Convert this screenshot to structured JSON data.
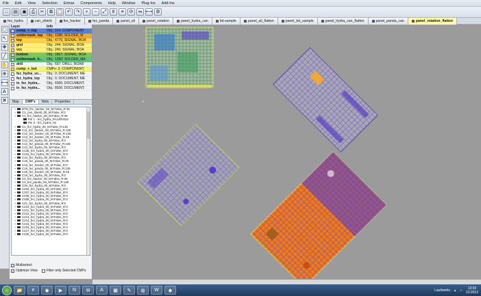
{
  "menu": [
    "File",
    "Edit",
    "View",
    "Selection",
    "Extras",
    "Components",
    "Help",
    "Window",
    "Plug-Ins",
    "Add-Ins"
  ],
  "toolbar_icons": [
    "new-icon",
    "open-icon",
    "save-icon",
    "print-icon",
    "cut-icon",
    "copy-icon",
    "paste-icon",
    "undo-icon",
    "redo-icon",
    "zoom-in-icon",
    "zoom-out-icon",
    "zoom-fit-icon",
    "grid-icon",
    "layer-icon",
    "rotate-icon",
    "mirror-icon",
    "measure-icon",
    "settings-icon"
  ],
  "tabs": [
    "fez_hydra",
    "can_shield",
    "fez_hacker",
    "fez_panda",
    "panel_all",
    "panel_rotation",
    "panel_hydra_can",
    "bd-sample",
    "panel_all_flatten",
    "panel_bd_sample",
    "panel_hydra_can_flatten",
    "panel_panda_can",
    "panel_rotation_flatten"
  ],
  "active_tab": "panel_rotation_flatten",
  "layer_panel": {
    "title": "Layer",
    "col_info": "Info",
    "layers": [
      {
        "name": "comp_+_top",
        "info": "Obj.: 114; COMPONENT",
        "color": "#5a7fd0"
      },
      {
        "name": "soldermask_top",
        "info": "Obj.: 1388; SOLDER_M",
        "color": "#f0a830"
      },
      {
        "name": "top",
        "info": "Obj.: 4775; SIGNAL; BOA",
        "color": "#ffd24a"
      },
      {
        "name": "gnd",
        "info": "Obj.: 244; SIGNAL; BOA",
        "color": "#ffef7a"
      },
      {
        "name": "vcc",
        "info": "Obj.: 240; SIGNAL; BOA",
        "color": "#ffef7a"
      },
      {
        "name": "bottom",
        "info": "Obj.: 1867; SIGNAL; BOA",
        "color": "#7ec85a"
      },
      {
        "name": "soldermask_b...",
        "info": "Obj.: 1282; SOLDER_MA",
        "color": "#66c27a"
      },
      {
        "name": "drill",
        "info": "Obj.: 697; DRILL; BOAR",
        "color": "#f2f3f5"
      },
      {
        "name": "comp_+_bot",
        "info": "CMPs: 3; COMPONENT;",
        "color": "#f4f37a"
      },
      {
        "name": "fez_hydra_so...",
        "info": "Obj.: 0; DOCUMENT; ME",
        "color": "#f2f3f5"
      },
      {
        "name": "fez_hydra_top",
        "info": "Obj.: 0; DOCUMENT; ME",
        "color": "#f2f3f5"
      },
      {
        "name": "in_fez_hydra...",
        "info": "Obj.: 6005; DOCUMENT;",
        "color": "#f2f3f5"
      },
      {
        "name": "in_fez_hydra...",
        "info": "Obj.: 8926; DOCUMENT;",
        "color": "#f2f3f5"
      }
    ]
  },
  "panel_tabs": [
    "Map",
    "CMP's",
    "Nets",
    "Properties"
  ],
  "tree_items": [
    {
      "t": "BTN_fez_hacker_00_M:False_R:45",
      "lvl": 1
    },
    {
      "t": "C1_can_shield_00_M:False_R:0",
      "lvl": 1
    },
    {
      "t": "C1_fez_hacker_00_M:False_R:45",
      "lvl": 1
    },
    {
      "t": "Pin 1 - fez_hydra_PA14/RXD2",
      "lvl": 2
    },
    {
      "t": "Pin 2 - fez_hydra_A0",
      "lvl": 2
    },
    {
      "t": "C1_fez_hydra_00_M:False_R:135",
      "lvl": 1
    },
    {
      "t": "C11_fez_hacker_00_M:False_R:135",
      "lvl": 1
    },
    {
      "t": "C12_fez_hacker_00_M:False_R:135",
      "lvl": 1
    },
    {
      "t": "C13_fez_hacker_00_M:False_R:45",
      "lvl": 1
    },
    {
      "t": "C12_fez_hydra_00_M:False_R:0",
      "lvl": 1
    },
    {
      "t": "C12_fez_panda_00_M:False_R:135",
      "lvl": 1
    },
    {
      "t": "C13_fez_hydra_00_M:False_R:0",
      "lvl": 1
    },
    {
      "t": "C130_fez_hydra_00_M:False_R:0",
      "lvl": 1
    },
    {
      "t": "C131_fez_hydra_00_M:False_R:0",
      "lvl": 1
    },
    {
      "t": "C14_fez_hydra_00_M:False_R:0",
      "lvl": 1
    },
    {
      "t": "C15_fez_panda_00_M:False_R:45",
      "lvl": 1
    },
    {
      "t": "C16_fez_hacker_00_M:False_R:0",
      "lvl": 1
    },
    {
      "t": "C16_fez_panda_00_M:False_R:135",
      "lvl": 1
    },
    {
      "t": "C19_fez_hacker_00_M:False_R:45",
      "lvl": 1
    },
    {
      "t": "C19_fez_hydra_00_M:False_R:0",
      "lvl": 1
    },
    {
      "t": "C2_fez_hacker_00_M:False_R:45",
      "lvl": 1
    },
    {
      "t": "C2_fez_panda_00_M:False_R:135",
      "lvl": 1
    },
    {
      "t": "C20_fez_hydra_00_M:False_R:0",
      "lvl": 1
    },
    {
      "t": "C204_fez_hydra_00_M:False_R:0",
      "lvl": 1
    },
    {
      "t": "C207_fez_hydra_00_M:False_R:0",
      "lvl": 1
    },
    {
      "t": "C208_fez_hydra_00_M:False_R:0",
      "lvl": 1
    },
    {
      "t": "C209_fez_hydra_00_M:False_R:0",
      "lvl": 1
    },
    {
      "t": "C21_fez_hydra_00_M:False_R:0",
      "lvl": 1
    },
    {
      "t": "C210_fez_hydra_00_M:False_R:0",
      "lvl": 1
    },
    {
      "t": "C211_fez_hydra_00_M:False_R:0",
      "lvl": 1
    },
    {
      "t": "C212_fez_hydra_00_M:False_R:0",
      "lvl": 1
    },
    {
      "t": "C213_fez_hydra_00_M:False_R:0",
      "lvl": 1
    },
    {
      "t": "C214_fez_hydra_00_M:False_R:0",
      "lvl": 1
    },
    {
      "t": "C215_fez_hydra_00_M:False_R:0",
      "lvl": 1
    },
    {
      "t": "C216_fez_hydra_00_M:False_R:0",
      "lvl": 1
    },
    {
      "t": "C217_fez_hydra_00_M:False_R:0",
      "lvl": 1
    },
    {
      "t": "C218_fez_hydra_00_M:False_R:0",
      "lvl": 1
    }
  ],
  "options": {
    "multiselect": "Multiselect",
    "optimize_view": "Optimize View",
    "filter_selected": "Filter only Selected CMPs"
  },
  "taskbar": {
    "apps": [
      "windows-start-icon",
      "explorer-icon",
      "ie-icon",
      "chrome-icon",
      "media-icon",
      "onenote-icon",
      "outlook-icon",
      "acrobat-icon",
      "access-icon",
      "paint-icon",
      "firefox-icon",
      "word-icon",
      "cam-icon"
    ],
    "tray_label": "Laufwerks",
    "time": "13:03",
    "date": "13.2012"
  },
  "colors": {
    "canvas": "#9b9b9b",
    "bottom_copper": "#5a3ec8",
    "top_copper": "#f07a1a",
    "silkscreen": "#e6e65a",
    "soldermask_green": "#7ec85a",
    "active_tab": "#fff8b0"
  }
}
